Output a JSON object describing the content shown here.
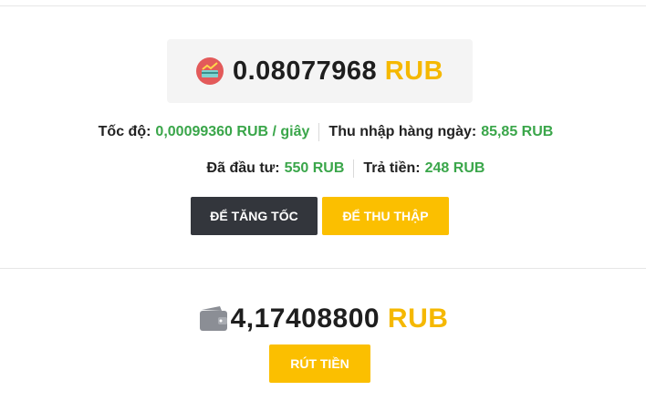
{
  "balance": {
    "value": "0.08077968",
    "currency": "RUB"
  },
  "stats": {
    "speed_label": "Tốc độ:",
    "speed_value": "0,00099360 RUB / giây",
    "daily_label": "Thu nhập hàng ngày:",
    "daily_value": "85,85 RUB",
    "invested_label": "Đã đầu tư:",
    "invested_value": "550 RUB",
    "paid_label": "Trả tiền:",
    "paid_value": "248 RUB"
  },
  "buttons": {
    "speed_up": "ĐỂ TĂNG TỐC",
    "collect": "ĐỂ THU THẬP",
    "withdraw": "RÚT TIỀN"
  },
  "wallet": {
    "value": "4,17408800",
    "currency": "RUB"
  },
  "colors": {
    "accent": "#fbbf00",
    "green": "#3aa64a",
    "dark_button": "#33363c",
    "coin_icon": "#e35a5a",
    "wallet_icon": "#8b8e95"
  },
  "icons": {
    "balance": "coin-chart-icon",
    "wallet": "wallet-icon"
  }
}
